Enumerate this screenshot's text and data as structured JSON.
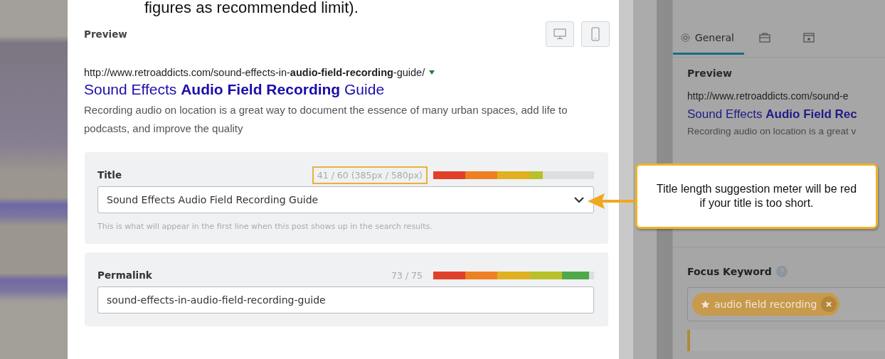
{
  "caption_fragment": "figures as recommended limit).",
  "preview": {
    "heading": "Preview",
    "url": "http://www.retroaddicts.com/sound-effects-in-**audio-field-recording**-guide/",
    "title": "Sound Effects **Audio Field Recording** Guide",
    "description": "Recording audio on location is a great way to document the essence of many urban spaces, add life to podcasts, and improve the quality"
  },
  "fields": [
    {
      "kind": "select",
      "label": "Title",
      "counter": "41 / 60 (385px / 580px)",
      "highlighted": true,
      "level": 0.68,
      "value": "Sound Effects Audio Field Recording Guide",
      "help": "This is what will appear in the first line when this post shows up in the search results."
    },
    {
      "kind": "text",
      "label": "Permalink",
      "counter": "73 / 75",
      "highlighted": false,
      "level": 0.97,
      "value": "sound-effects-in-audio-field-recording-guide"
    }
  ],
  "sidebar": {
    "tabs": [
      {
        "kind": "general",
        "label": "General",
        "selected": true
      },
      {
        "kind": "briefcase",
        "selected": false
      },
      {
        "kind": "window",
        "selected": false
      }
    ],
    "preview": {
      "heading": "Preview",
      "url": "http://www.retroaddicts.com/sound-e",
      "title": "Sound Effects **Audio Field Rec**",
      "description": "Recording audio on location is a great v"
    },
    "focus_keyword": {
      "label": "Focus Keyword",
      "keywords": [
        "audio field recording"
      ]
    }
  },
  "callout": "Title length suggestion meter will be red if your title is too short."
}
